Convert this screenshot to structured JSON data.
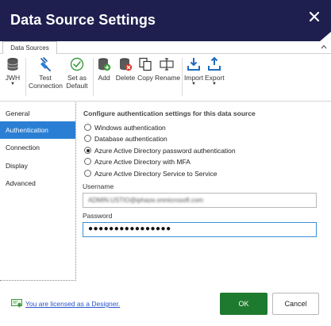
{
  "window": {
    "title": "Data Source Settings",
    "title_bar_color": "#1f1f4f"
  },
  "ribbon": {
    "tab_label": "Data Sources",
    "buttons": [
      {
        "label": "JWH",
        "icon": "database-icon",
        "has_dropdown": true
      },
      {
        "label_line1": "Test",
        "label_line2": "Connection",
        "icon": "plug-icon"
      },
      {
        "label_line1": "Set as",
        "label_line2": "Default",
        "icon": "check-circle-icon"
      },
      {
        "label": "Add",
        "icon": "database-add-icon"
      },
      {
        "label": "Delete",
        "icon": "database-delete-icon"
      },
      {
        "label": "Copy",
        "icon": "copy-icon"
      },
      {
        "label": "Rename",
        "icon": "rename-icon"
      },
      {
        "label": "Import",
        "icon": "import-icon",
        "has_dropdown": true
      },
      {
        "label": "Export",
        "icon": "export-icon",
        "has_dropdown": true
      }
    ]
  },
  "nav": {
    "items": [
      {
        "label": "General"
      },
      {
        "label": "Authentication",
        "active": true
      },
      {
        "label": "Connection"
      },
      {
        "label": "Display"
      },
      {
        "label": "Advanced"
      }
    ],
    "active_color": "#2a7fd4"
  },
  "auth": {
    "heading": "Configure authentication settings for this data source",
    "options": [
      {
        "label": "Windows authentication",
        "selected": false
      },
      {
        "label": "Database authentication",
        "selected": false
      },
      {
        "label": "Azure Active Directory password authentication",
        "selected": true
      },
      {
        "label": "Azure Active Directory with MFA",
        "selected": false
      },
      {
        "label": "Azure Active Directory Service to Service",
        "selected": false
      }
    ],
    "username_label": "Username",
    "username_value": "ADMIN.USTIO@iphaze.onmicrosoft.com",
    "password_label": "Password",
    "password_value": "●●●●●●●●●●●●●●●●"
  },
  "footer": {
    "license_text": "You are licensed as a Designer.",
    "ok_label": "OK",
    "cancel_label": "Cancel",
    "ok_color": "#1e7a2e"
  }
}
